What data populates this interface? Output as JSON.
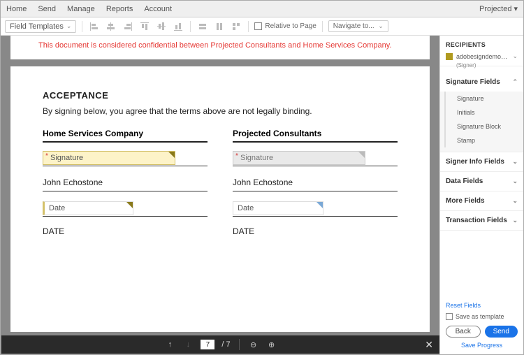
{
  "topnav": {
    "items": [
      "Home",
      "Send",
      "Manage",
      "Reports",
      "Account"
    ],
    "right": "Projected"
  },
  "toolbar": {
    "fieldTemplates": "Field Templates",
    "relativeToPage": "Relative to Page",
    "navigateTo": "Navigate to..."
  },
  "banner": "This document is considered confidential between Projected Consultants and Home Services Company.",
  "doc": {
    "heading": "ACCEPTANCE",
    "subtext": "By signing below, you agree that the terms above are not legally binding.",
    "left": {
      "title": "Home Services Company",
      "sigLabel": "Signature",
      "name": "John Echostone",
      "dateField": "Date",
      "dateLabel": "DATE"
    },
    "right": {
      "title": "Projected Consultants",
      "sigLabel": "Signature",
      "name": "John Echostone",
      "dateField": "Date",
      "dateLabel": "DATE"
    }
  },
  "pager": {
    "current": "7",
    "total": "7"
  },
  "sidebar": {
    "recipientsHeader": "RECIPIENTS",
    "recipient": {
      "name": "adobesigndemo+custo...",
      "role": "(Signer)"
    },
    "categories": {
      "signatureFields": "Signature Fields",
      "sigItems": [
        "Signature",
        "Initials",
        "Signature Block",
        "Stamp"
      ],
      "signerInfo": "Signer Info Fields",
      "dataFields": "Data Fields",
      "moreFields": "More Fields",
      "transactionFields": "Transaction Fields"
    },
    "footer": {
      "reset": "Reset Fields",
      "saveTpl": "Save as template",
      "back": "Back",
      "send": "Send",
      "saveProgress": "Save Progress"
    }
  }
}
